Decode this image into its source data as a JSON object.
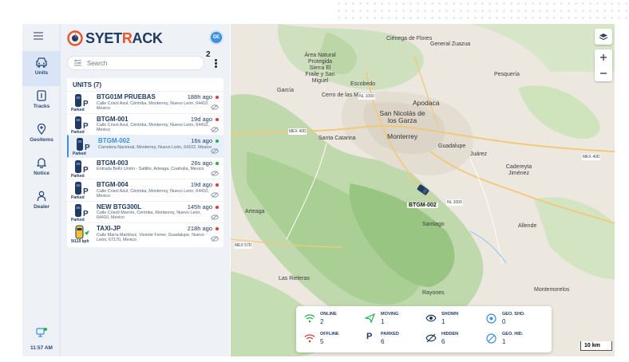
{
  "app": {
    "brand_prefix": "SYET",
    "brand_accent": "R",
    "brand_suffix": "ACK",
    "avatar_initials": "DE"
  },
  "colors": {
    "brand_dark": "#1f3a63",
    "accent": "#e8542b",
    "online": "#22b14c",
    "offline": "#e53935",
    "selected": "#3d8fe0"
  },
  "rail": {
    "items": [
      {
        "label": "Units",
        "icon": "car-icon",
        "active": true
      },
      {
        "label": "Tracks",
        "icon": "route-icon"
      },
      {
        "label": "Geoitems",
        "icon": "location-pin-icon"
      },
      {
        "label": "Notice",
        "icon": "bell-icon"
      },
      {
        "label": "Dealer",
        "icon": "person-icon"
      }
    ],
    "time": "11:57 AM"
  },
  "search": {
    "placeholder": "Search",
    "badge": "2"
  },
  "units": {
    "title": "UNITS (7)",
    "items": [
      {
        "name": "BTG01M PRUEBAS",
        "ago": "188h ago",
        "status": "offline",
        "state": "Parked",
        "address": "Calle Crisol Azul, Céntrika, Monterrey, Nuevo León, 64410, Mexico"
      },
      {
        "name": "BTGM-001",
        "ago": "19d ago",
        "status": "offline",
        "state": "Parked",
        "address": "Calle Crisol Azul, Céntrika, Monterrey, Nuevo León, 64410, Mexico"
      },
      {
        "name": "BTGM-002",
        "ago": "16s ago",
        "status": "online",
        "state": "Parked",
        "address": "Carretera Nacional, Monterrey, Nuevo León, 64102, Mexico",
        "selected": true
      },
      {
        "name": "BTGM-003",
        "ago": "26s ago",
        "status": "online",
        "state": "Parked",
        "address": "Entrada Bello Unión - Saltillo, Arteaga, Coahuila, Mexico"
      },
      {
        "name": "BTGM-004",
        "ago": "19d ago",
        "status": "offline",
        "state": "Parked",
        "address": "Calle Crisol Azul, Céntrika, Monterrey, Nuevo León, 64410, Mexico"
      },
      {
        "name": "NEW BTG300L",
        "ago": "145h ago",
        "status": "offline",
        "state": "Parked",
        "address": "Calle Crisoli Marrón, Céntrika, Monterrey, Nuevo León, 64410, Mexico"
      },
      {
        "name": "TAXI-JP",
        "ago": "218h ago",
        "status": "offline",
        "state": "9/110 kph",
        "address": "Calle María Martínez, Vicente Ferrer, Guadalupe, Nuevo León, 67170, Mexico"
      }
    ]
  },
  "map": {
    "labels": {
      "apodaca": "Apodaca",
      "san_nicolas": "San Nicolás de los Garza",
      "monterrey": "Monterrey",
      "garcia": "García",
      "area_natural": "Área Natural Protegida Sierra El Fraile y San Miguel",
      "cerro": "Cerro de las Mitras",
      "escobedo": "Escobedo",
      "guadalupe": "Guadalupe",
      "juarez": "Juárez",
      "santa_catarina": "Santa Catarina",
      "pesqueria": "Pesquería",
      "cadereyta": "Cadereyta Jiménez",
      "santiago": "Santiago",
      "montemorelos": "Montemorelos",
      "rayones": "Rayones",
      "arteaga": "Arteaga",
      "las_rieleras": "Las Rieleras",
      "allende": "Allende",
      "general_zuazua": "General Zuazua",
      "cienega": "Ciénega de Flores"
    },
    "roads": [
      "NL 1000",
      "MEX 40D",
      "MEX 40D",
      "NL 1000",
      "MEX 57D"
    ],
    "vehicle_label": "BTGM-002",
    "scale": "10 km"
  },
  "legend": {
    "online": {
      "label": "ONLINE",
      "value": "2"
    },
    "offline": {
      "label": "OFFLINE",
      "value": "5"
    },
    "moving": {
      "label": "MOVING",
      "value": "1"
    },
    "parked": {
      "label": "PARKED",
      "value": "6"
    },
    "shown": {
      "label": "SHOWN",
      "value": "1"
    },
    "hidden": {
      "label": "HIDDEN",
      "value": "6"
    },
    "geo_sho": {
      "label": "GEO. SHO.",
      "value": "0"
    },
    "geo_hid": {
      "label": "GEO. HID.",
      "value": "1"
    }
  }
}
